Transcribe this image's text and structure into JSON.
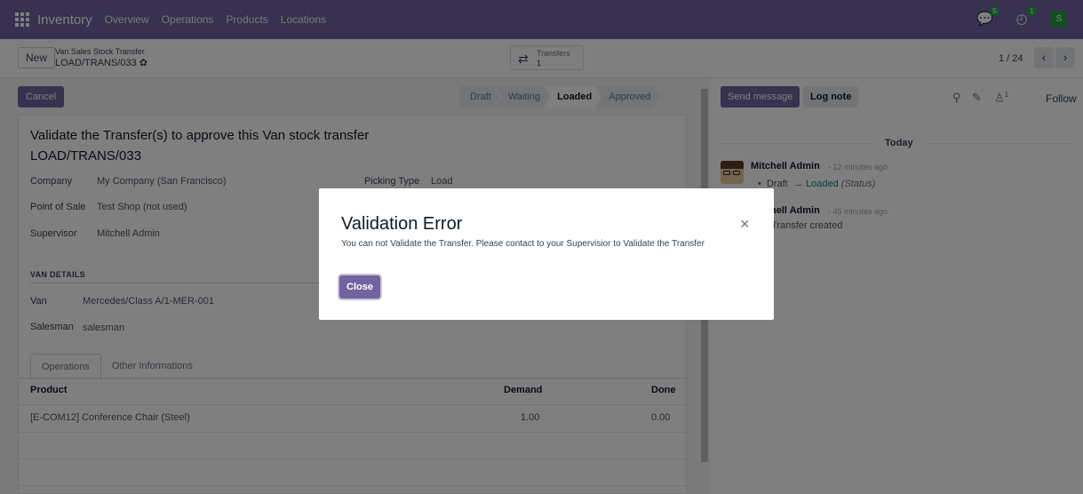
{
  "topnav": {
    "app_name": "Inventory",
    "items": [
      "Overview",
      "Operations",
      "Products",
      "Locations"
    ],
    "messages_count": "5",
    "activities_count": "1",
    "user_initial": "S",
    "accent": "#71639e"
  },
  "controlbar": {
    "new_label": "New",
    "breadcrumb_parent": "Van Sales Stock Transfer",
    "breadcrumb_current": "LOAD/TRANS/033",
    "smart_button_label": "Transfers",
    "smart_button_value": "1",
    "pager_value": "1 / 24"
  },
  "form": {
    "cancel_label": "Cancel",
    "stages": [
      "Draft",
      "Waiting",
      "Loaded",
      "Approved"
    ],
    "active_stage": "Loaded",
    "title_line1": "Validate the Transfer(s) to approve this Van stock transfer",
    "title_line2": "LOAD/TRANS/033",
    "fields": {
      "company_label": "Company",
      "company_value": "My Company (San Francisco)",
      "picking_type_label": "Picking Type",
      "picking_type_value": "Load",
      "pos_label": "Point of Sale",
      "pos_value": "Test Shop (not used)",
      "supervisor_label": "Supervisor",
      "supervisor_value": "Mitchell Admin"
    },
    "van_section_title": "VAN DETAILS",
    "van_label": "Van",
    "van_value": "Mercedes/Class A/1-MER-001",
    "salesman_label": "Salesman",
    "salesman_value": "salesman",
    "tabs": [
      "Operations",
      "Other Informations"
    ],
    "table": {
      "headers": [
        "Product",
        "Demand",
        "Done"
      ],
      "rows": [
        {
          "product": "[E-COM12] Conference Chair (Steel)",
          "demand": "1.00",
          "done": "0.00"
        }
      ]
    }
  },
  "chatter": {
    "send_message_label": "Send message",
    "log_note_label": "Log note",
    "followers_count": "1",
    "follow_label": "Follow",
    "today_label": "Today",
    "messages": [
      {
        "author": "Mitchell Admin",
        "time": "- 12 minutes ago",
        "old": "Draft",
        "arrow": "→",
        "new": "Loaded",
        "field": "(Status)"
      },
      {
        "author": "Mitchell Admin",
        "author_visible": "hell Admin",
        "time": "- 45 minutes ago",
        "body": "tock Transfer created"
      }
    ]
  },
  "modal": {
    "title": "Validation Error",
    "body": "You can not Validate the Transfer. Please contact to your Supervisior to Validate the Transfer",
    "close_label": "Close",
    "close_icon": "×"
  }
}
